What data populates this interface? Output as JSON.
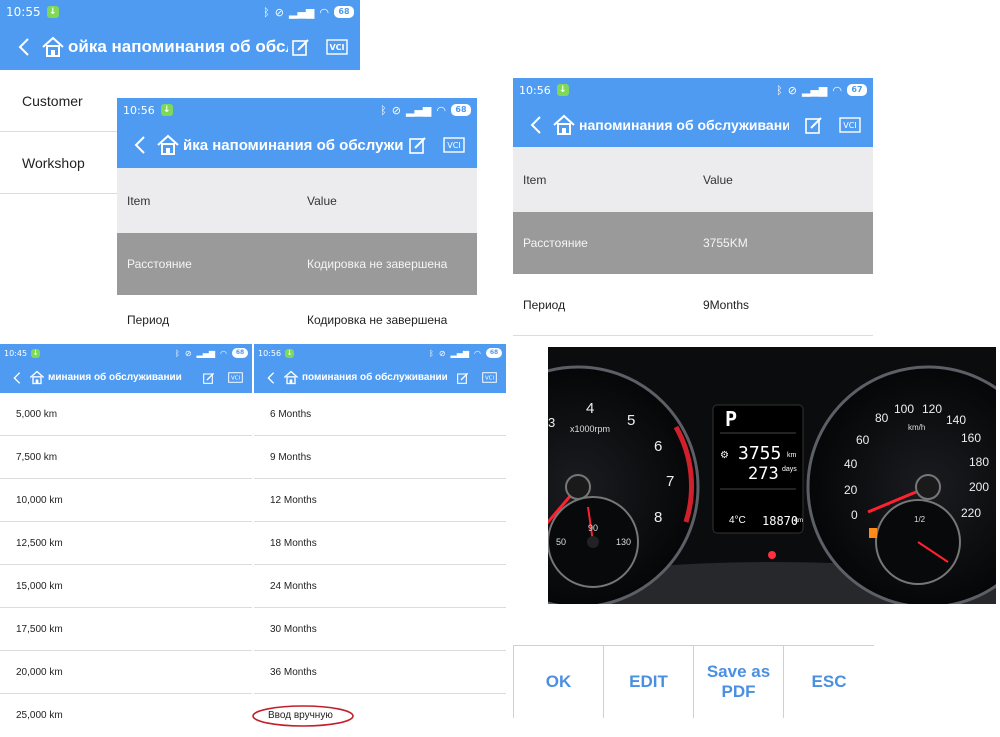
{
  "screen_a": {
    "status": {
      "time": "10:55",
      "battery": "68"
    },
    "title": "ойка напоминания об обслужи",
    "sidebar": [
      "Customer",
      "Workshop"
    ]
  },
  "screen_b": {
    "status": {
      "time": "10:56",
      "battery": "68"
    },
    "title": "йка напоминания об обслужи",
    "header": {
      "item": "Item",
      "value": "Value"
    },
    "rows": [
      {
        "item": "Расстояние",
        "value": "Кодировка не завершена"
      },
      {
        "item": "Период",
        "value": "Кодировка не завершена"
      }
    ]
  },
  "screen_c": {
    "status": {
      "time": "10:56",
      "battery": "67"
    },
    "title": "напоминания об обслуживани",
    "header": {
      "item": "Item",
      "value": "Value"
    },
    "rows": [
      {
        "item": "Расстояние",
        "value": "3755KM"
      },
      {
        "item": "Период",
        "value": "9Months"
      }
    ]
  },
  "screen_d": {
    "status": {
      "time": "10:45",
      "battery": "68"
    },
    "title": "минания об обслуживании",
    "items": [
      "5,000 km",
      "7,500 km",
      "10,000 km",
      "12,500 km",
      "15,000 km",
      "17,500 km",
      "20,000 km",
      "25,000 km"
    ]
  },
  "screen_e": {
    "status": {
      "time": "10:56",
      "battery": "68"
    },
    "title": "поминания об обслуживании",
    "items": [
      "6 Months",
      "9 Months",
      "12 Months",
      "18 Months",
      "24 Months",
      "30 Months",
      "36 Months",
      "Ввод вручную"
    ]
  },
  "dashboard": {
    "gear": "P",
    "distance": "3755",
    "distance_unit": "km",
    "days": "273",
    "days_unit": "days",
    "temp": "4°C",
    "odometer": "18870",
    "odo_unit": "km",
    "rpm_label": "x1000rpm",
    "speed_unit": "km/h",
    "tach_ticks": [
      "3",
      "4",
      "5",
      "6",
      "7",
      "8"
    ],
    "speed_ticks": [
      "0",
      "20",
      "40",
      "60",
      "80",
      "100",
      "120",
      "140",
      "160",
      "180",
      "200",
      "220"
    ],
    "temp_ticks": [
      "50",
      "90",
      "130"
    ],
    "fuel_label": "1/2"
  },
  "buttons": {
    "ok": "OK",
    "edit": "EDIT",
    "save_pdf": "Save as PDF",
    "esc": "ESC"
  },
  "colors": {
    "accent": "#4f9bf2",
    "row_gray": "#9a9a9a",
    "header_gray": "#ececee",
    "highlight": "#c0202a"
  }
}
